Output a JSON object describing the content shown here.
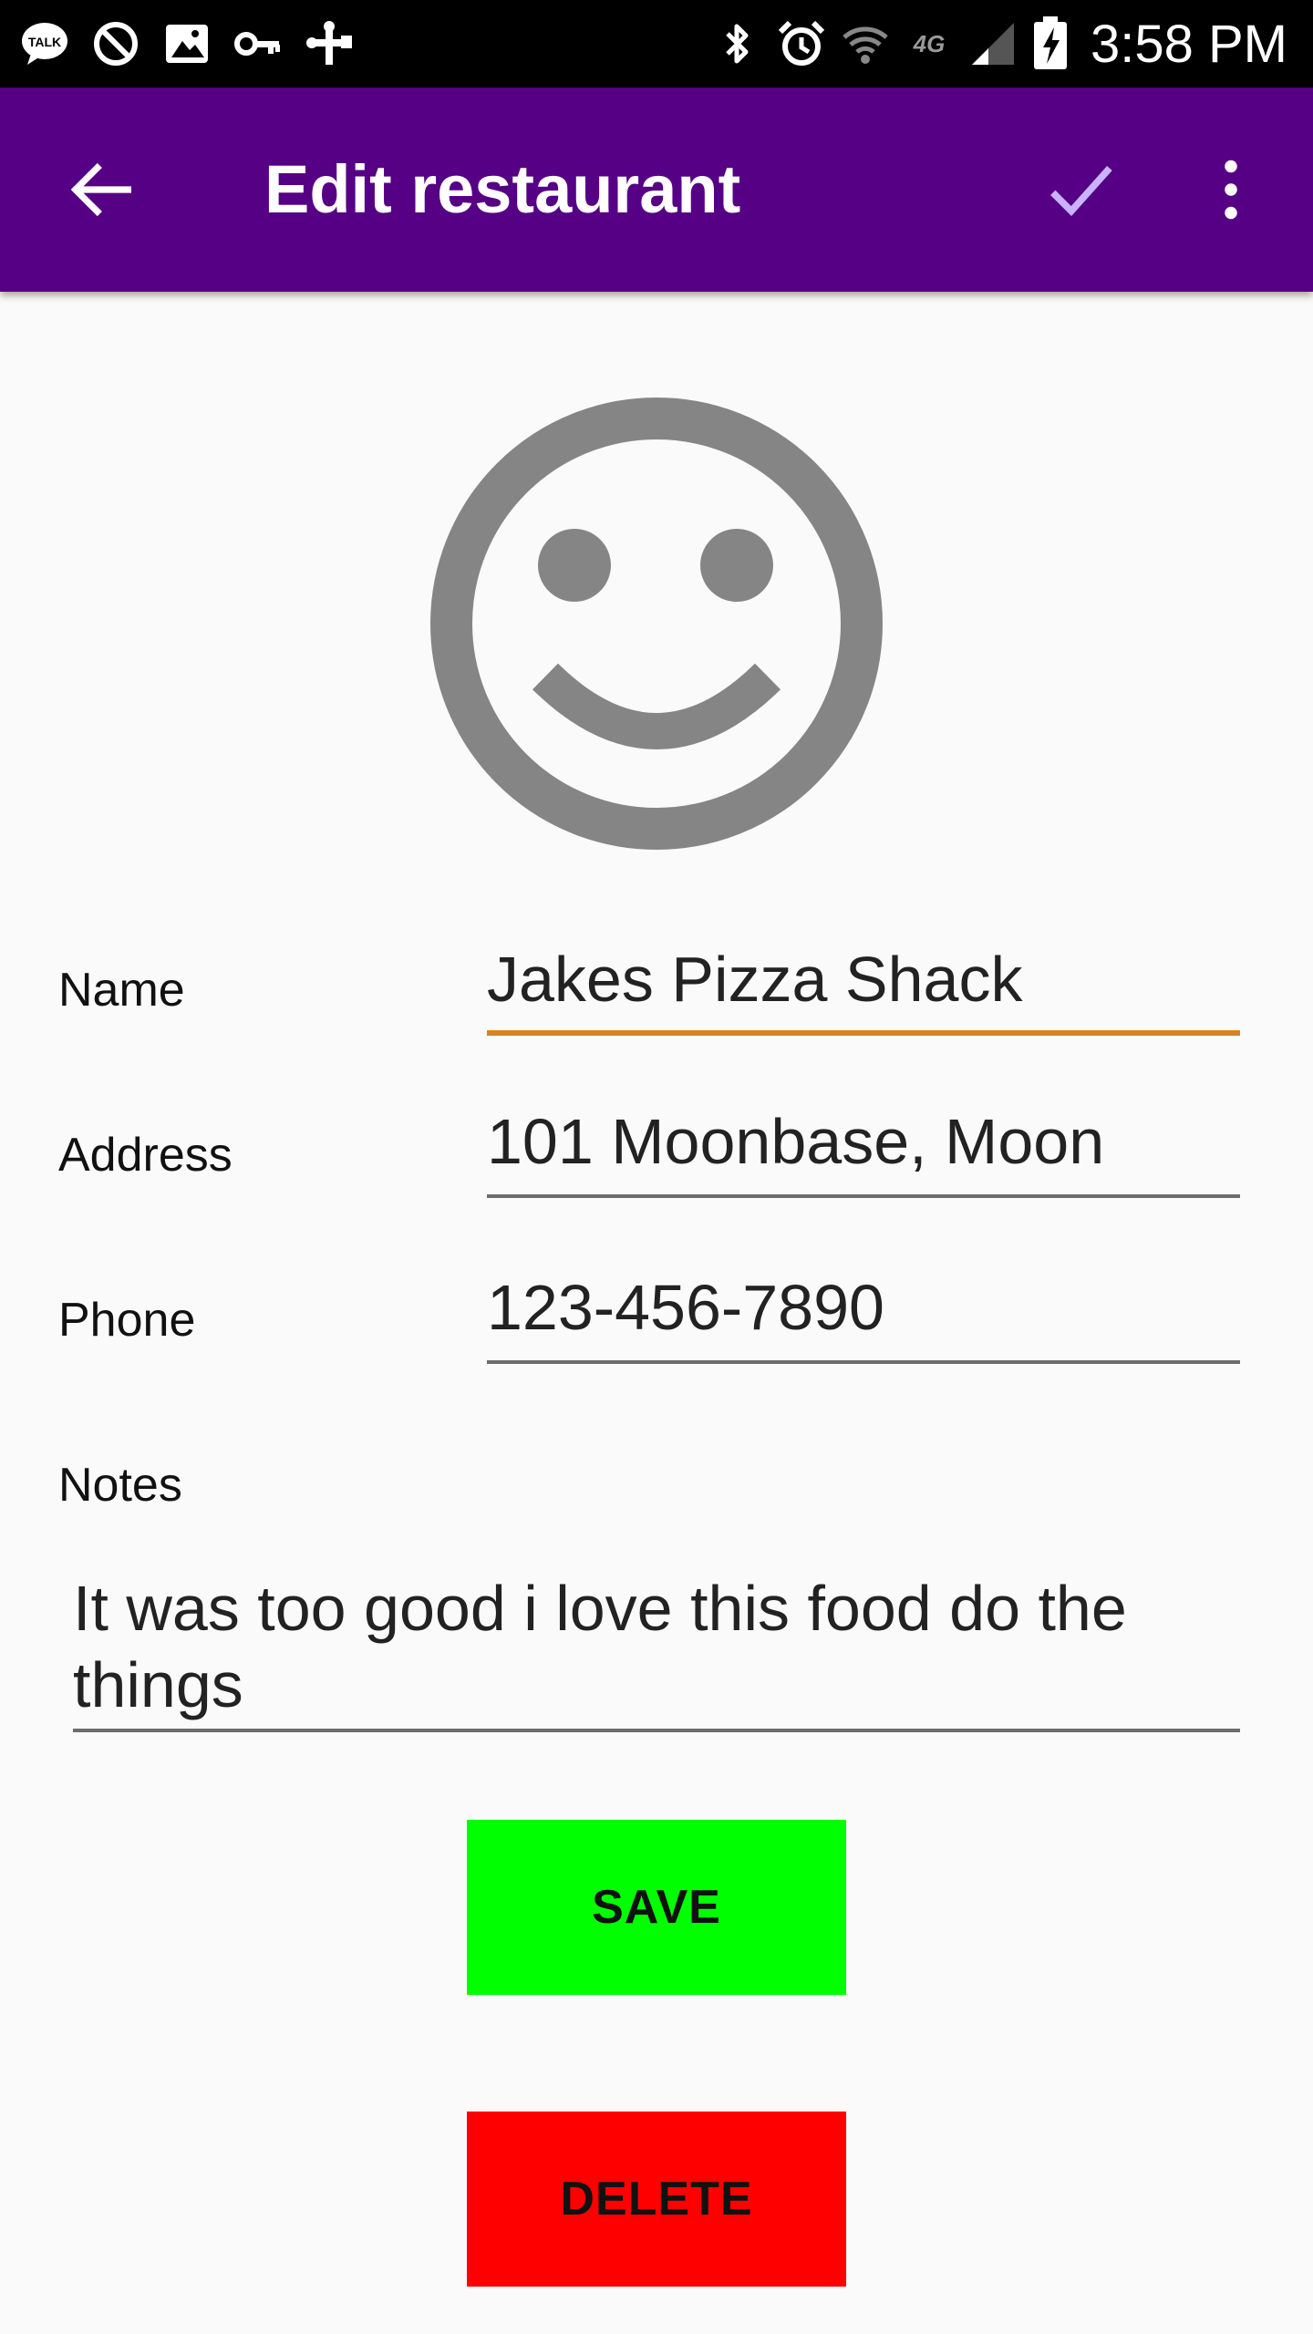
{
  "status_bar": {
    "time": "3:58 PM",
    "network": "4G",
    "left_icons": [
      "talk-icon",
      "do-not-disturb-icon",
      "image-icon",
      "key-icon",
      "usb-icon"
    ],
    "right_icons": [
      "bluetooth-icon",
      "alarm-icon",
      "wifi-icon",
      "signal-icon",
      "battery-charging-icon"
    ]
  },
  "app_bar": {
    "title": "Edit restaurant",
    "background": "#560085",
    "actions": [
      "arrow-back-icon",
      "check-icon",
      "more-vert-icon"
    ]
  },
  "form": {
    "avatar": "smiley-face-icon",
    "name": {
      "label": "Name",
      "value": "Jakes Pizza Shack"
    },
    "address": {
      "label": "Address",
      "value": "101 Moonbase, Moon"
    },
    "phone": {
      "label": "Phone",
      "value": "123-456-7890"
    },
    "notes": {
      "label": "Notes",
      "value": "It was too good i love this food do the things"
    }
  },
  "buttons": {
    "save_label": "SAVE",
    "save_color": "#00ff00",
    "delete_label": "DELETE",
    "delete_color": "#ff0000"
  },
  "colors": {
    "focus_underline": "#d9821f"
  }
}
